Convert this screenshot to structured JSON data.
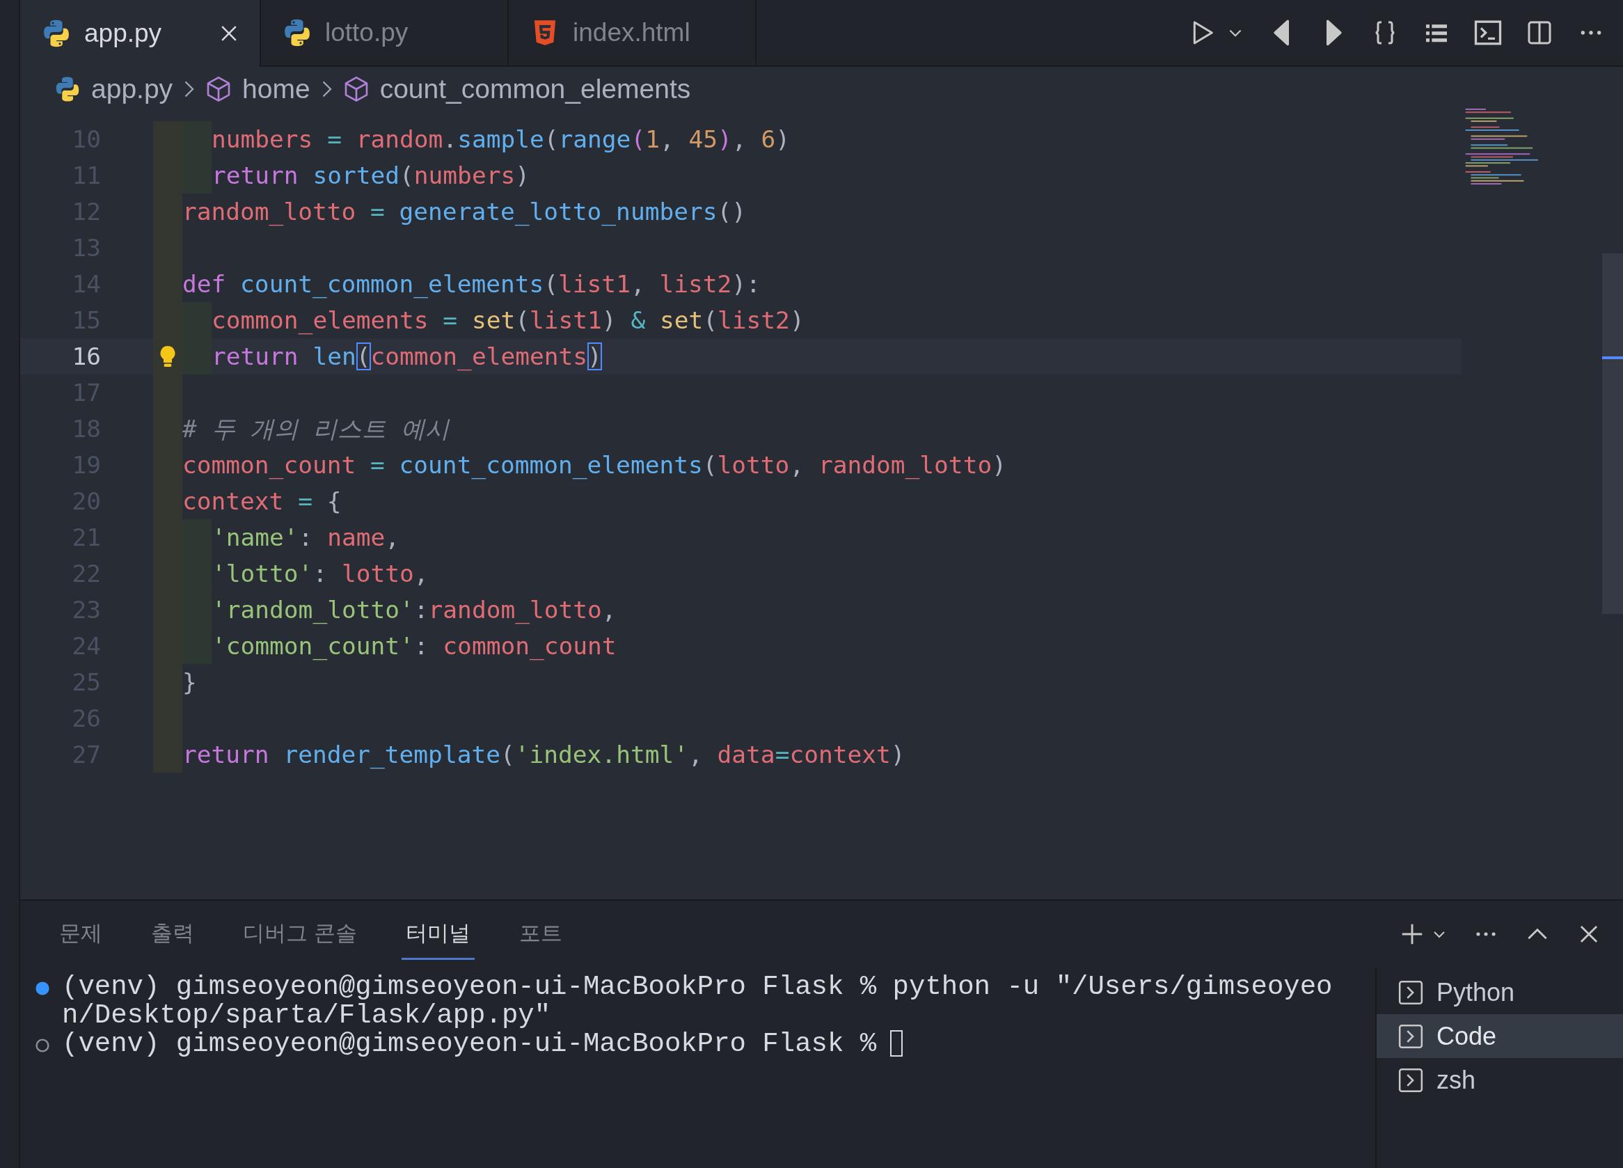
{
  "tabs": [
    {
      "label": "app.py",
      "kind": "python",
      "selected": true
    },
    {
      "label": "lotto.py",
      "kind": "python",
      "selected": false
    },
    {
      "label": "index.html",
      "kind": "html",
      "selected": false
    }
  ],
  "breadcrumb": [
    {
      "label": "app.py",
      "kind": "file"
    },
    {
      "label": "home",
      "kind": "symbol"
    },
    {
      "label": "count_common_elements",
      "kind": "symbol"
    }
  ],
  "editor": {
    "lines": [
      {
        "number": "10",
        "indented": true,
        "current": false,
        "tokens": [
          {
            "kind": "var",
            "text": "numbers"
          },
          {
            "kind": "op",
            "text": " = "
          },
          {
            "kind": "var",
            "text": "random"
          },
          {
            "kind": "punc",
            "text": "."
          },
          {
            "kind": "fn",
            "text": "sample"
          },
          {
            "kind": "punc",
            "text": "("
          },
          {
            "kind": "fn",
            "text": "range"
          },
          {
            "kind": "paren",
            "text": "("
          },
          {
            "kind": "num",
            "text": "1"
          },
          {
            "kind": "punc",
            "text": ", "
          },
          {
            "kind": "num",
            "text": "45"
          },
          {
            "kind": "paren",
            "text": ")"
          },
          {
            "kind": "punc",
            "text": ", "
          },
          {
            "kind": "num",
            "text": "6"
          },
          {
            "kind": "punc",
            "text": ")"
          }
        ]
      },
      {
        "number": "11",
        "indented": true,
        "current": false,
        "tokens": [
          {
            "kind": "kw",
            "text": "return "
          },
          {
            "kind": "fn",
            "text": "sorted"
          },
          {
            "kind": "punc",
            "text": "("
          },
          {
            "kind": "var",
            "text": "numbers"
          },
          {
            "kind": "punc",
            "text": ")"
          }
        ]
      },
      {
        "number": "12",
        "indented": false,
        "current": false,
        "tokens": [
          {
            "kind": "var",
            "text": "random_lotto"
          },
          {
            "kind": "op",
            "text": " = "
          },
          {
            "kind": "fn",
            "text": "generate_lotto_numbers"
          },
          {
            "kind": "punc",
            "text": "()"
          }
        ]
      },
      {
        "number": "13",
        "indented": false,
        "current": false
      },
      {
        "number": "14",
        "indented": false,
        "current": false,
        "tokens": [
          {
            "kind": "kw",
            "text": "def "
          },
          {
            "kind": "fn",
            "text": "count_common_elements"
          },
          {
            "kind": "punc",
            "text": "("
          },
          {
            "kind": "var",
            "text": "list1"
          },
          {
            "kind": "punc",
            "text": ", "
          },
          {
            "kind": "var",
            "text": "list2"
          },
          {
            "kind": "punc",
            "text": "):"
          }
        ]
      },
      {
        "number": "15",
        "indented": true,
        "current": false,
        "tokens": [
          {
            "kind": "var",
            "text": "common_elements"
          },
          {
            "kind": "op",
            "text": " = "
          },
          {
            "kind": "cls",
            "text": "set"
          },
          {
            "kind": "punc",
            "text": "("
          },
          {
            "kind": "var",
            "text": "list1"
          },
          {
            "kind": "punc",
            "text": ")"
          },
          {
            "kind": "op",
            "text": " & "
          },
          {
            "kind": "cls",
            "text": "set"
          },
          {
            "kind": "punc",
            "text": "("
          },
          {
            "kind": "var",
            "text": "list2"
          },
          {
            "kind": "punc",
            "text": ")"
          }
        ]
      },
      {
        "number": "16",
        "indented": true,
        "current": true,
        "lightbulb": true,
        "tokens": [
          {
            "kind": "kw",
            "text": "return "
          },
          {
            "kind": "fn",
            "text": "len"
          },
          {
            "kind": "bracket",
            "text": "("
          },
          {
            "kind": "var",
            "text": "common_elements"
          },
          {
            "kind": "bracket",
            "text": ")"
          }
        ]
      },
      {
        "number": "17",
        "indented": false,
        "current": false
      },
      {
        "number": "18",
        "indented": false,
        "current": false,
        "tokens": [
          {
            "kind": "comment",
            "text": "# 두 개의 리스트 예시"
          }
        ]
      },
      {
        "number": "19",
        "indented": false,
        "current": false,
        "tokens": [
          {
            "kind": "var",
            "text": "common_count"
          },
          {
            "kind": "op",
            "text": " = "
          },
          {
            "kind": "fn",
            "text": "count_common_elements"
          },
          {
            "kind": "punc",
            "text": "("
          },
          {
            "kind": "var",
            "text": "lotto"
          },
          {
            "kind": "punc",
            "text": ", "
          },
          {
            "kind": "var",
            "text": "random_lotto"
          },
          {
            "kind": "punc",
            "text": ")"
          }
        ]
      },
      {
        "number": "20",
        "indented": false,
        "current": false,
        "tokens": [
          {
            "kind": "var",
            "text": "context"
          },
          {
            "kind": "op",
            "text": " = "
          },
          {
            "kind": "punc",
            "text": "{"
          }
        ]
      },
      {
        "number": "21",
        "indented": true,
        "current": false,
        "tokens": [
          {
            "kind": "str",
            "text": "'name'"
          },
          {
            "kind": "punc",
            "text": ": "
          },
          {
            "kind": "var",
            "text": "name"
          },
          {
            "kind": "punc",
            "text": ","
          }
        ]
      },
      {
        "number": "22",
        "indented": true,
        "current": false,
        "tokens": [
          {
            "kind": "str",
            "text": "'lotto'"
          },
          {
            "kind": "punc",
            "text": ": "
          },
          {
            "kind": "var",
            "text": "lotto"
          },
          {
            "kind": "punc",
            "text": ","
          }
        ]
      },
      {
        "number": "23",
        "indented": true,
        "current": false,
        "tokens": [
          {
            "kind": "str",
            "text": "'random_lotto'"
          },
          {
            "kind": "punc",
            "text": ":"
          },
          {
            "kind": "var",
            "text": "random_lotto"
          },
          {
            "kind": "punc",
            "text": ","
          }
        ]
      },
      {
        "number": "24",
        "indented": true,
        "current": false,
        "tokens": [
          {
            "kind": "str",
            "text": "'common_count'"
          },
          {
            "kind": "punc",
            "text": ": "
          },
          {
            "kind": "var",
            "text": "common_count"
          }
        ]
      },
      {
        "number": "25",
        "indented": false,
        "current": false,
        "tokens": [
          {
            "kind": "punc",
            "text": "}"
          }
        ]
      },
      {
        "number": "26",
        "indented": false,
        "current": false
      },
      {
        "number": "27",
        "indented": false,
        "current": false,
        "tokens": [
          {
            "kind": "kw",
            "text": "return "
          },
          {
            "kind": "fn",
            "text": "render_template"
          },
          {
            "kind": "punc",
            "text": "("
          },
          {
            "kind": "str",
            "text": "'index.html'"
          },
          {
            "kind": "punc",
            "text": ", "
          },
          {
            "kind": "var",
            "text": "data"
          },
          {
            "kind": "op",
            "text": "="
          },
          {
            "kind": "var",
            "text": "context"
          },
          {
            "kind": "punc",
            "text": ")"
          }
        ]
      }
    ]
  },
  "panel": {
    "tabs": [
      {
        "label": "문제",
        "selected": false
      },
      {
        "label": "출력",
        "selected": false
      },
      {
        "label": "디버그 콘솔",
        "selected": false
      },
      {
        "label": "터미널",
        "selected": true
      },
      {
        "label": "포트",
        "selected": false
      }
    ],
    "terminal": {
      "lines": [
        {
          "kind": "ran",
          "text": "(venv) gimseoyeon@gimseoyeon-ui-MacBookPro Flask % python -u \"/Users/gimseoyeon/Desktop/sparta/Flask/app.py\""
        },
        {
          "kind": "idle",
          "text": "(venv) gimseoyeon@gimseoyeon-ui-MacBookPro Flask %",
          "cursor": true
        }
      ]
    },
    "terminals": [
      {
        "label": "Python",
        "selected": false
      },
      {
        "label": "Code",
        "selected": true
      },
      {
        "label": "zsh",
        "selected": false
      }
    ]
  }
}
